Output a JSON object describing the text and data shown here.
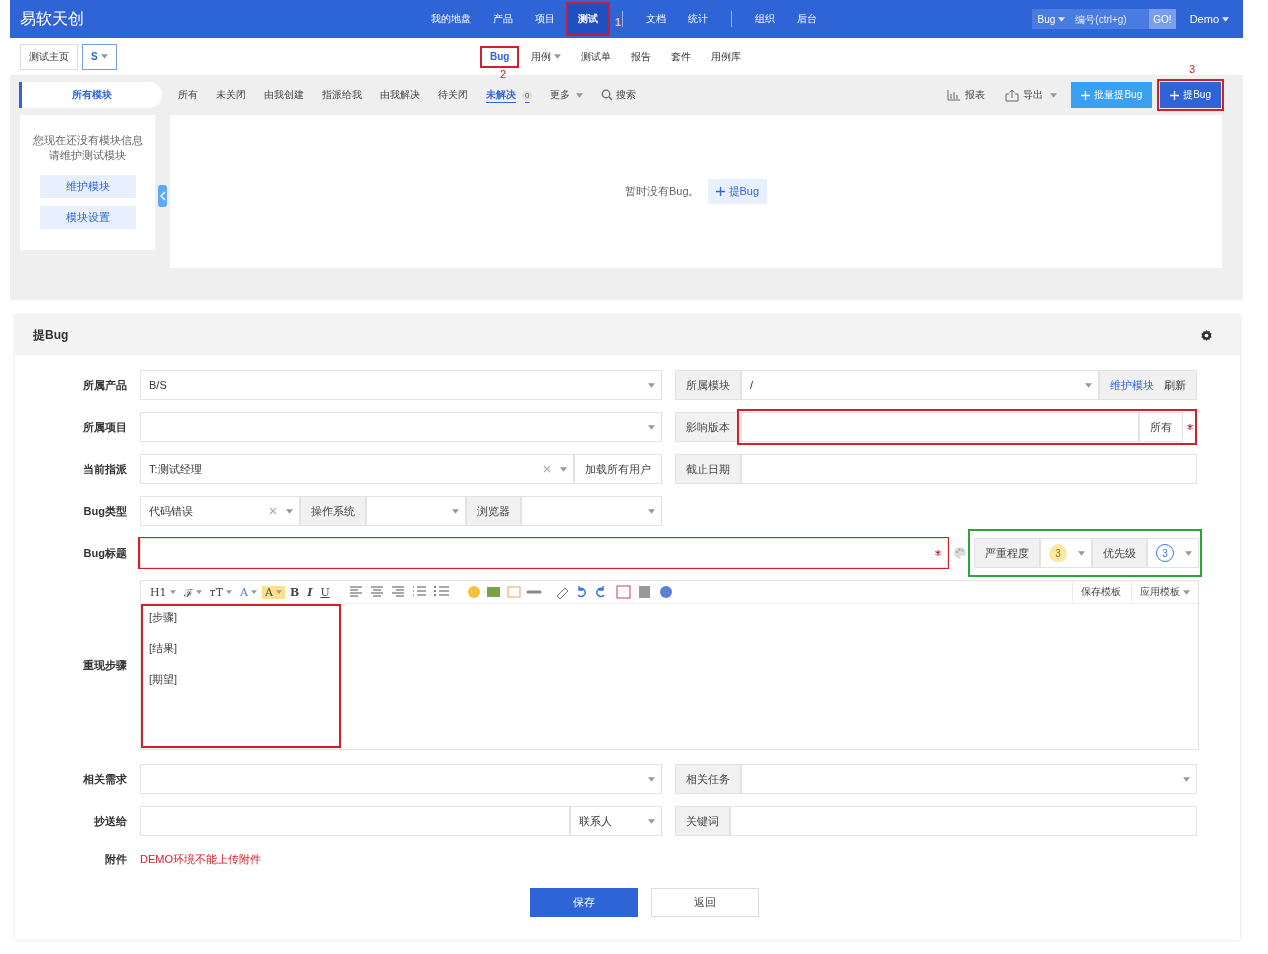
{
  "header": {
    "logo": "易软天创",
    "nav_groups": [
      [
        {
          "label": "我的地盘",
          "selected": false
        },
        {
          "label": "产品",
          "selected": false
        },
        {
          "label": "项目",
          "selected": false
        },
        {
          "label": "测试",
          "selected": true,
          "annotation": "1"
        }
      ],
      [
        {
          "label": "文档",
          "selected": false
        },
        {
          "label": "统计",
          "selected": false
        }
      ],
      [
        {
          "label": "组织",
          "selected": false
        },
        {
          "label": "后台",
          "selected": false
        }
      ]
    ],
    "search": {
      "type": "Bug",
      "placeholder": "编号(ctrl+g)",
      "button": "GO!"
    },
    "user": "Demo"
  },
  "subnav": {
    "breadcrumb": [
      {
        "label": "测试主页",
        "dropdown": false
      },
      {
        "label": "S",
        "dropdown": true
      }
    ],
    "items": [
      {
        "label": "Bug",
        "selected": true,
        "dropdown": false,
        "annotation": "2"
      },
      {
        "label": "用例",
        "selected": false,
        "dropdown": true
      },
      {
        "label": "测试单",
        "selected": false,
        "dropdown": false
      },
      {
        "label": "报告",
        "selected": false,
        "dropdown": false
      },
      {
        "label": "套件",
        "selected": false,
        "dropdown": false
      },
      {
        "label": "用例库",
        "selected": false,
        "dropdown": false
      }
    ]
  },
  "toolbar": {
    "module_tab": "所有模块",
    "filters": [
      {
        "label": "所有",
        "selected": false
      },
      {
        "label": "未关闭",
        "selected": false
      },
      {
        "label": "由我创建",
        "selected": false
      },
      {
        "label": "指派给我",
        "selected": false
      },
      {
        "label": "由我解决",
        "selected": false
      },
      {
        "label": "待关闭",
        "selected": false
      },
      {
        "label": "未解决",
        "selected": true,
        "count": "0"
      }
    ],
    "more": "更多",
    "search": "搜索",
    "actions": [
      {
        "kind": "report",
        "label": "报表"
      },
      {
        "kind": "export",
        "label": "导出"
      },
      {
        "kind": "batch",
        "label": "批量提Bug"
      },
      {
        "kind": "create",
        "label": "提Bug",
        "annotation": "3"
      }
    ]
  },
  "sidebar": {
    "message": [
      "您现在还没有模块信息",
      "请维护测试模块"
    ],
    "buttons": [
      "维护模块",
      "模块设置"
    ]
  },
  "empty_state": {
    "message": "暂时没有Bug。",
    "action": "提Bug"
  },
  "form": {
    "title": "提Bug",
    "product": {
      "label": "所属产品",
      "value": "B/S"
    },
    "module": {
      "label": "所属模块",
      "value": "/",
      "links": [
        "维护模块",
        "刷新"
      ]
    },
    "project": {
      "label": "所属项目"
    },
    "build": {
      "label": "影响版本",
      "addon": "所有",
      "required": true,
      "marked": true
    },
    "assigned_to": {
      "label": "当前指派",
      "value": "T:测试经理",
      "addon": "加载所有用户"
    },
    "deadline": {
      "label": "截止日期"
    },
    "type": {
      "label": "Bug类型",
      "value": "代码错误"
    },
    "os": {
      "label": "操作系统"
    },
    "browser": {
      "label": "浏览器"
    },
    "title_field": {
      "label": "Bug标题",
      "required": true,
      "marked": true
    },
    "severity": {
      "label": "严重程度",
      "value": "3"
    },
    "priority": {
      "label": "优先级",
      "value": "3"
    },
    "rating_marked": true,
    "steps": {
      "label": "重现步骤",
      "tools": [
        {
          "label": "H1",
          "dropdown": true
        },
        {
          "label": "ℱ",
          "dropdown": true
        },
        {
          "label": "тT",
          "dropdown": true
        },
        {
          "label": "A",
          "dropdown": true
        },
        {
          "label": "A",
          "dropdown": true
        },
        {
          "label": "B",
          "dropdown": false
        },
        {
          "label": "I",
          "dropdown": false
        },
        {
          "label": "U",
          "dropdown": false
        }
      ],
      "template_buttons": [
        {
          "label": "保存模板",
          "dropdown": false
        },
        {
          "label": "应用模板",
          "dropdown": true
        }
      ],
      "lines": [
        "[步骤]",
        "[结果]",
        "[期望]"
      ],
      "marked": true
    },
    "story": {
      "label": "相关需求"
    },
    "task": {
      "label": "相关任务"
    },
    "mailto": {
      "label": "抄送给",
      "addon": "联系人"
    },
    "keywords": {
      "label": "关键词"
    },
    "files": {
      "label": "附件",
      "notice": "DEMO环境不能上传附件"
    },
    "buttons": [
      {
        "kind": "primary",
        "label": "保存"
      },
      {
        "kind": "default",
        "label": "返回"
      }
    ]
  }
}
